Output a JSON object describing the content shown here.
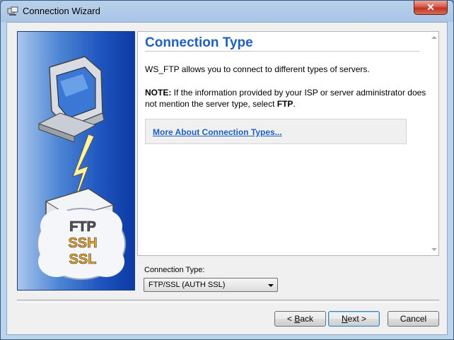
{
  "window": {
    "title": "Connection Wizard",
    "close_label": "✕"
  },
  "page": {
    "heading": "Connection Type",
    "description": "WS_FTP allows you to connect to different types of servers.",
    "note_label": "NOTE:",
    "note_text": " If the information provided by your ISP or server administrator does not mention the server type, select ",
    "note_bold": "FTP",
    "note_end": ".",
    "link_text": "More About Connection Types..."
  },
  "art": {
    "protocols": [
      "FTP",
      "SSH",
      "SSL"
    ]
  },
  "connection_type": {
    "label": "Connection Type:",
    "value": "FTP/SSL (AUTH SSL)"
  },
  "buttons": {
    "back_prefix": "< ",
    "back_mnemonic": "B",
    "back_rest": "ack",
    "next_mnemonic": "N",
    "next_rest": "ext >",
    "cancel": "Cancel"
  },
  "colors": {
    "accent": "#1f5fbf",
    "panel_blue": "#1f56bf",
    "close_red": "#c23420"
  }
}
